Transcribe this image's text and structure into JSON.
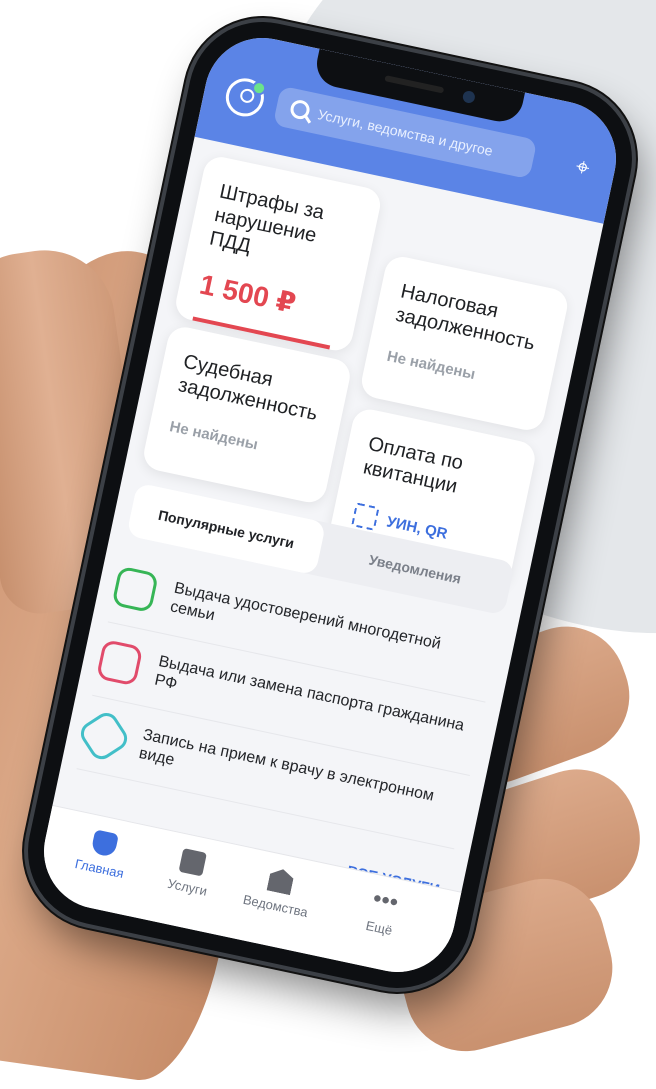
{
  "header": {
    "search_placeholder": "Услуги, ведомства и другое"
  },
  "tiles": {
    "fines": {
      "title": "Штрафы за нарушение ПДД",
      "amount": "1 500 ₽"
    },
    "tax": {
      "title": "Налоговая задолженность",
      "status": "Не найдены"
    },
    "court": {
      "title": "Судебная задолженность",
      "status": "Не найдены"
    },
    "receipt": {
      "title": "Оплата по квитанции",
      "action": "УИН, QR"
    }
  },
  "tabs": {
    "popular": "Популярные услуги",
    "notifications": "Уведомления"
  },
  "services": [
    {
      "label": "Выдача удостоверений многодетной семьи"
    },
    {
      "label": "Выдача или замена паспорта гражданина РФ"
    },
    {
      "label": "Запись на прием к врачу в электронном виде"
    }
  ],
  "all_services": "ВСЕ УСЛУГИ",
  "nav": {
    "home": "Главная",
    "services": "Услуги",
    "departments": "Ведомства",
    "more": "Ещё"
  },
  "colors": {
    "accent": "#3d6fde",
    "header": "#5b84e6",
    "fine": "#e34751"
  }
}
